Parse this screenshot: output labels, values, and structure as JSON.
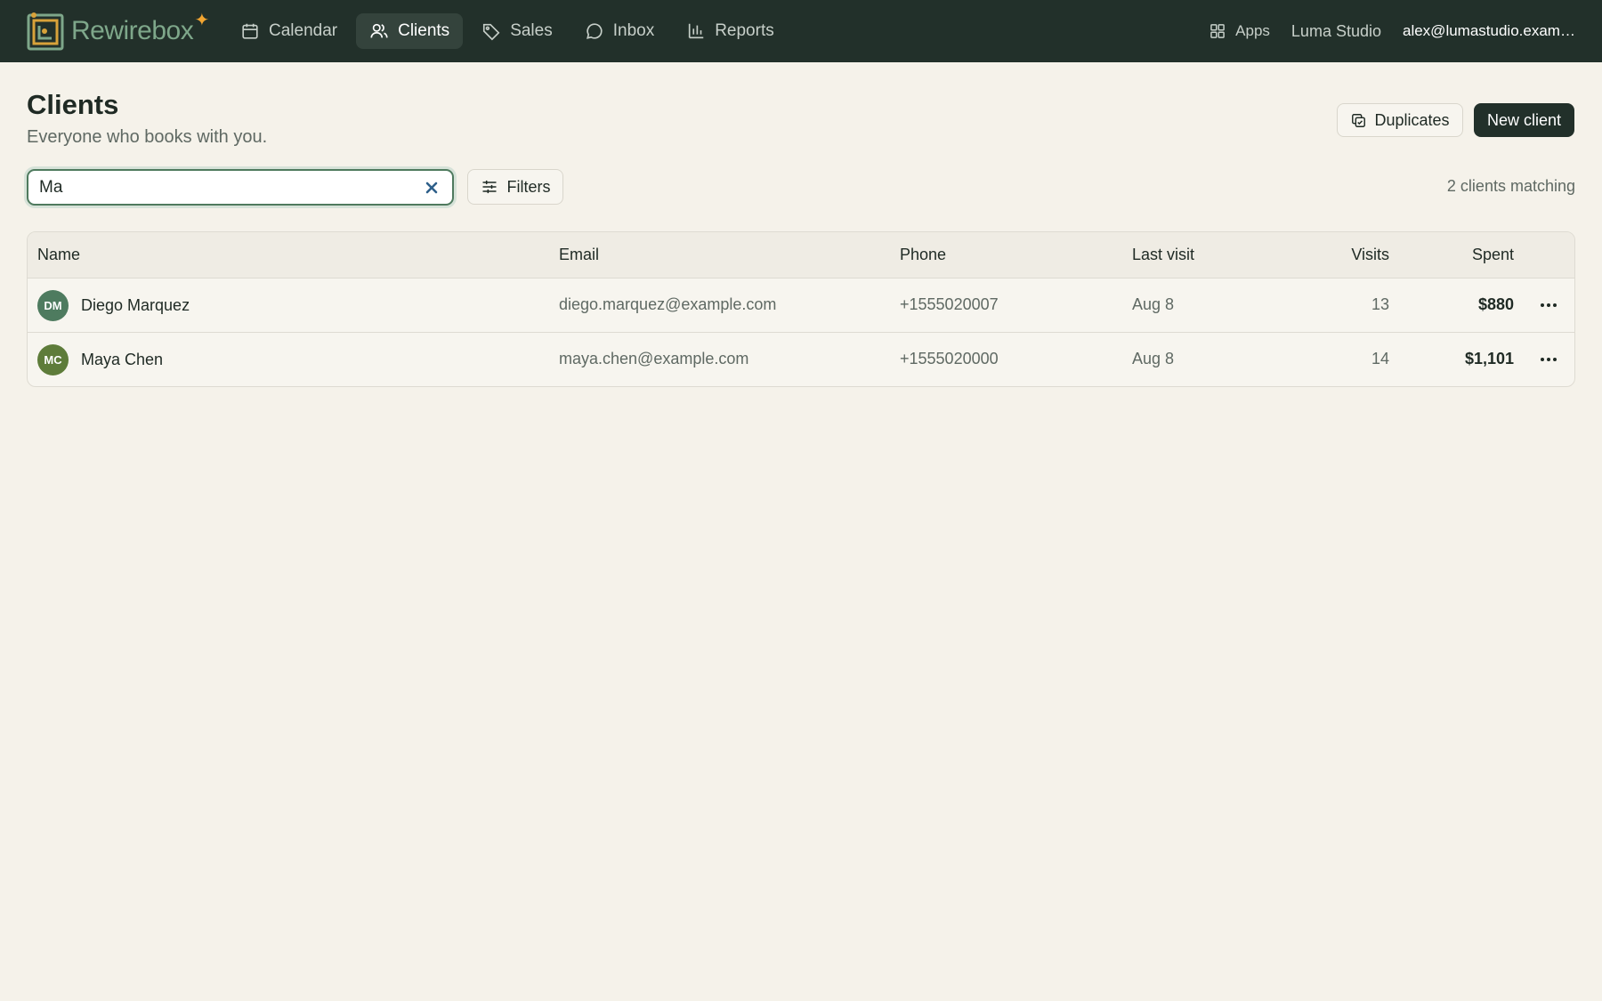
{
  "brand": {
    "name": "Rewirebox",
    "spark": "✦"
  },
  "nav": [
    {
      "label": "Calendar",
      "icon": "calendar-icon",
      "active": false
    },
    {
      "label": "Clients",
      "icon": "users-icon",
      "active": true
    },
    {
      "label": "Sales",
      "icon": "tag-icon",
      "active": false
    },
    {
      "label": "Inbox",
      "icon": "chat-icon",
      "active": false
    },
    {
      "label": "Reports",
      "icon": "bar-chart-icon",
      "active": false
    }
  ],
  "topright": {
    "apps_label": "Apps",
    "studio": "Luma Studio",
    "user_email": "alex@lumastudio.example.com"
  },
  "header": {
    "title": "Clients",
    "subtitle": "Everyone who books with you.",
    "duplicates_label": "Duplicates",
    "new_client_label": "New client"
  },
  "search": {
    "value": "Ma",
    "placeholder": ""
  },
  "filters_label": "Filters",
  "match_count": "2 clients matching",
  "table": {
    "columns": [
      "Name",
      "Email",
      "Phone",
      "Last visit",
      "Visits",
      "Spent"
    ],
    "rows": [
      {
        "initials": "DM",
        "avatar_color": "#4e7b5f",
        "name": "Diego Marquez",
        "email": "diego.marquez@example.com",
        "phone": "+1555020007",
        "last_visit": "Aug 8",
        "visits": "13",
        "spent": "$880"
      },
      {
        "initials": "MC",
        "avatar_color": "#5e7c3a",
        "name": "Maya Chen",
        "email": "maya.chen@example.com",
        "phone": "+1555020000",
        "last_visit": "Aug 8",
        "visits": "14",
        "spent": "$1,101"
      }
    ]
  },
  "colors": {
    "topbar": "#22302a",
    "background": "#f5f2ea",
    "accent": "#4f7a5e",
    "brand_spark": "#f2a531"
  }
}
